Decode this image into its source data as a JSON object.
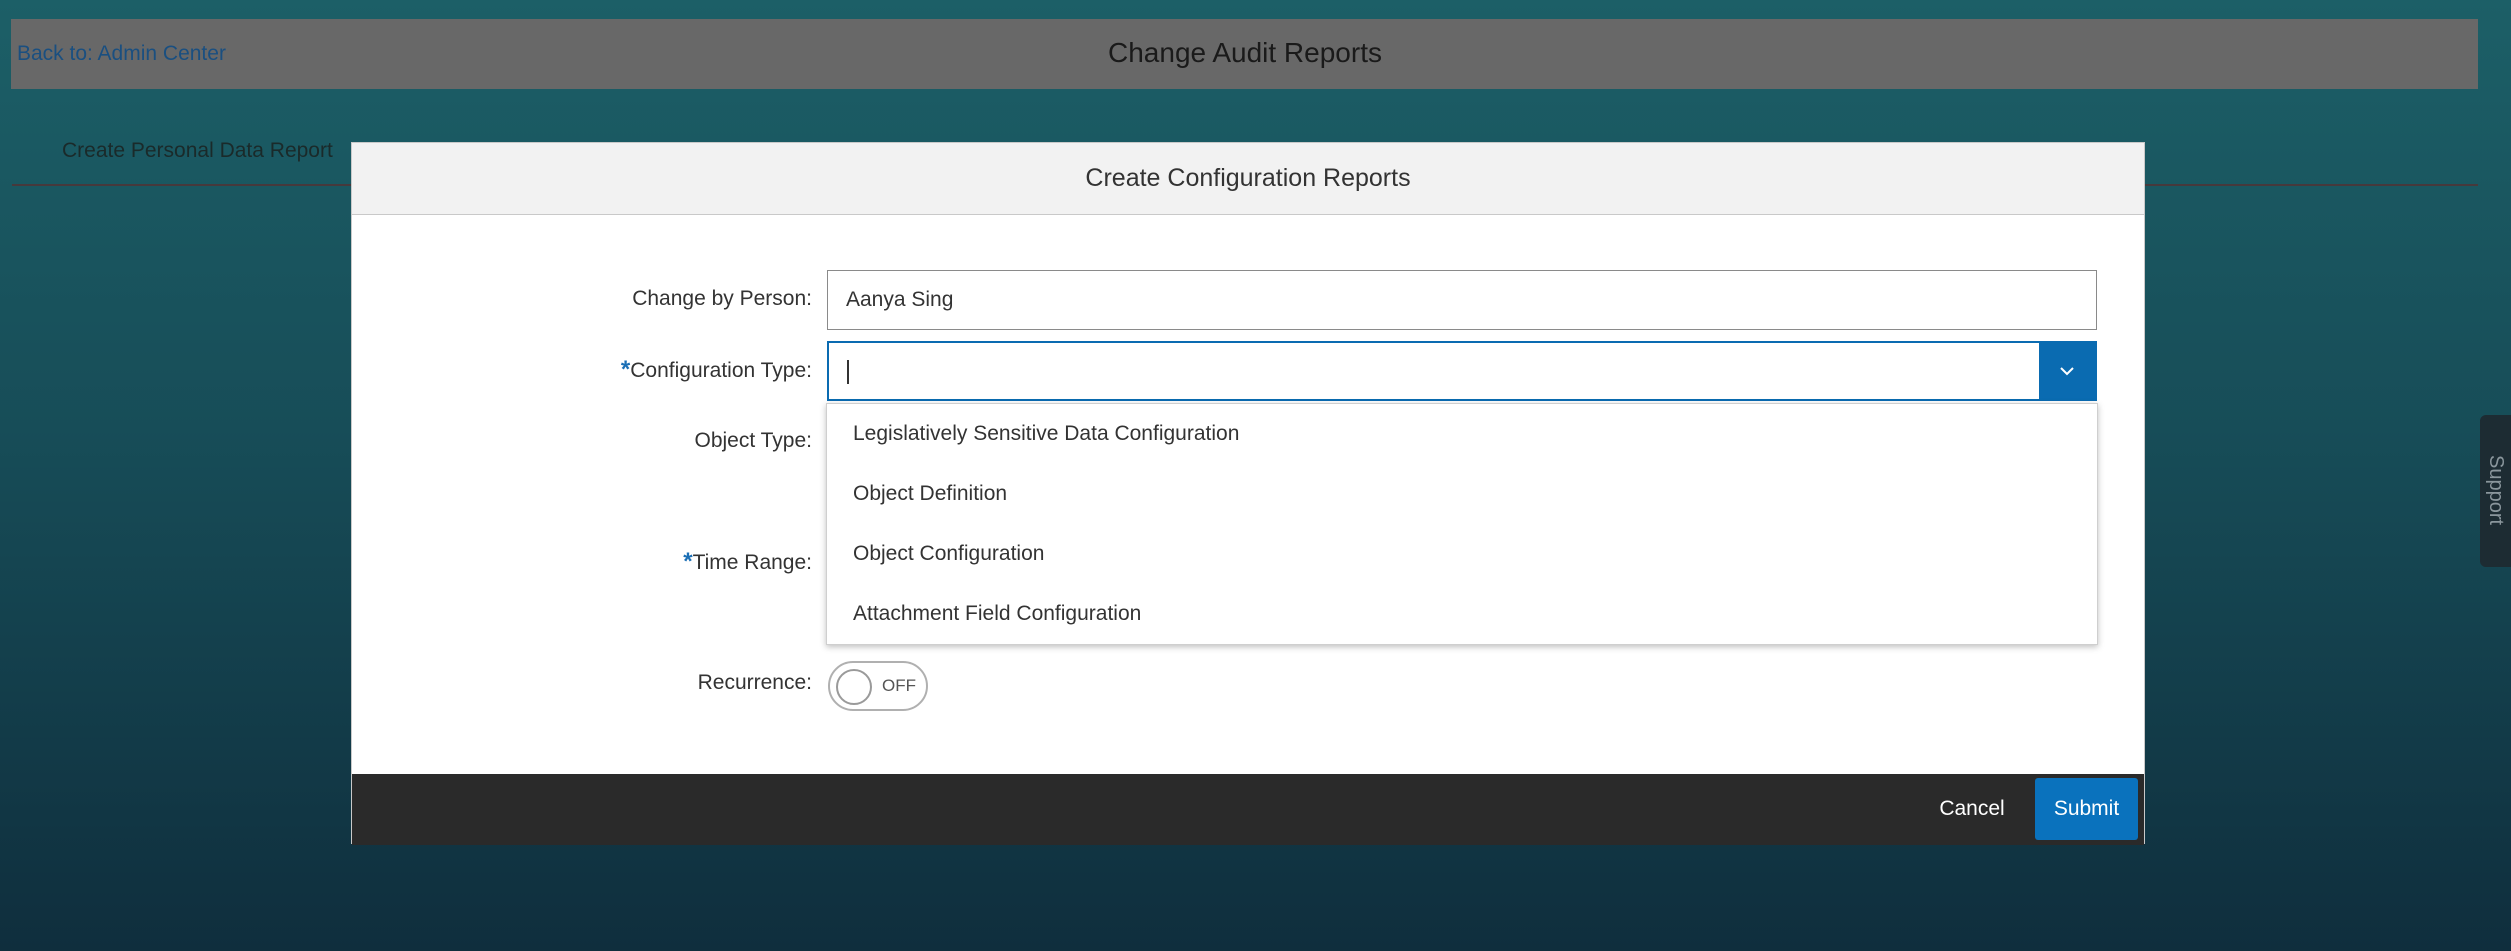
{
  "background": {
    "back_link": "Back to: Admin Center",
    "page_title": "Change Audit Reports",
    "tab_label": "Create Personal Data Report",
    "support_label": "Support"
  },
  "dialog": {
    "title": "Create Configuration Reports",
    "fields": {
      "change_by_person": {
        "label": "Change by Person:",
        "value": "Aanya Sing"
      },
      "configuration_type": {
        "required_mark": "*",
        "label": "Configuration Type:",
        "value": ""
      },
      "object_type": {
        "label": "Object Type:"
      },
      "time_range": {
        "required_mark": "*",
        "label": "Time Range:"
      },
      "recurrence": {
        "label": "Recurrence:",
        "state": "OFF"
      }
    },
    "dropdown_options": [
      "Legislatively Sensitive Data Configuration",
      "Object Definition",
      "Object Configuration",
      "Attachment Field Configuration"
    ],
    "footer": {
      "cancel_label": "Cancel",
      "submit_label": "Submit"
    }
  },
  "colors": {
    "accent": "#0a6bb1",
    "footer_bg": "#2a2a2a",
    "overlay_bg": "#174d58"
  },
  "icons": {
    "combo_toggle": "chevron-down-icon"
  }
}
